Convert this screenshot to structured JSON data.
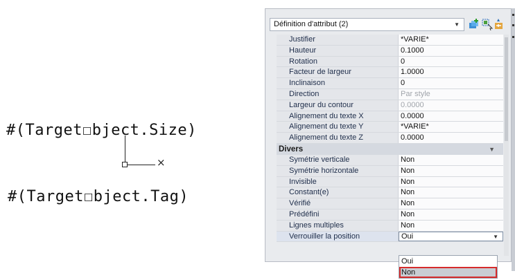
{
  "drawing": {
    "attr_size": "#(Target☐bject.Size)",
    "attr_tag": "#(Target☐bject.Tag)",
    "ucs_axis_label": "×"
  },
  "palette": {
    "selector_value": "Définition d'attribut (2)",
    "toolbar_icons": [
      "quick-select-icon",
      "select-objects-icon",
      "toggle-pickadd-icon"
    ],
    "text_rows": [
      {
        "label": "Justifier",
        "value": "*VARIE*"
      },
      {
        "label": "Hauteur",
        "value": "0.1000"
      },
      {
        "label": "Rotation",
        "value": "0"
      },
      {
        "label": "Facteur de largeur",
        "value": "1.0000"
      },
      {
        "label": "Inclinaison",
        "value": "0"
      },
      {
        "label": "Direction",
        "value": "Par style"
      },
      {
        "label": "Largeur du contour",
        "value": "0.0000"
      },
      {
        "label": "Alignement du texte X",
        "value": "0.0000"
      },
      {
        "label": "Alignement du texte Y",
        "value": "*VARIE*"
      },
      {
        "label": "Alignement du texte Z",
        "value": "0.0000"
      }
    ],
    "group_divers": "Divers",
    "misc_rows": [
      {
        "label": "Symétrie verticale",
        "value": "Non"
      },
      {
        "label": "Symétrie horizontale",
        "value": "Non"
      },
      {
        "label": "Invisible",
        "value": "Non"
      },
      {
        "label": "Constant(e)",
        "value": "Non"
      },
      {
        "label": "Vérifié",
        "value": "Non"
      },
      {
        "label": "Prédéfini",
        "value": "Non"
      },
      {
        "label": "Lignes multiples",
        "value": "Non"
      },
      {
        "label": "Verrouiller la position",
        "value": "Oui"
      }
    ],
    "dropdown_options": [
      "Oui",
      "Non"
    ]
  }
}
